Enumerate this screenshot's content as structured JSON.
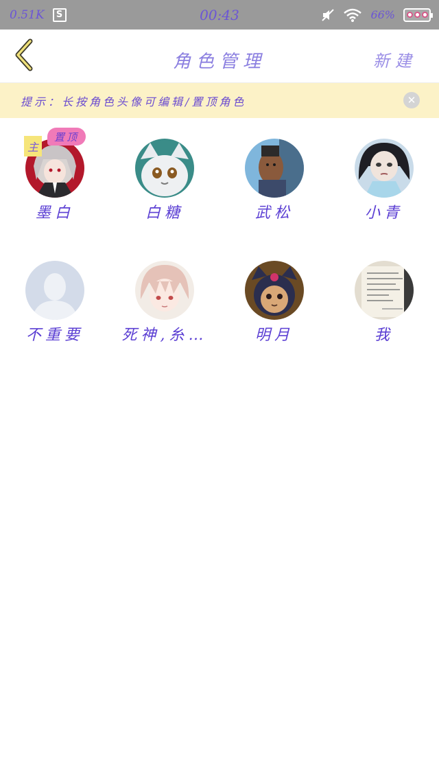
{
  "status_bar": {
    "speed": "0.51K",
    "time": "00:43",
    "battery_percent": "66%",
    "icons": [
      "s-app-icon",
      "mute-icon",
      "wifi-icon",
      "battery-icon"
    ]
  },
  "header": {
    "back_icon": "chevron-left-icon",
    "title": "角色管理",
    "new_label": "新建"
  },
  "hint": {
    "text": "提示：长按角色头像可编辑/置顶角色",
    "close_icon": "close-icon"
  },
  "characters": [
    {
      "name": "墨白",
      "badge_main": "主",
      "badge_pinned": "置顶"
    },
    {
      "name": "白糖"
    },
    {
      "name": "武松"
    },
    {
      "name": "小青"
    },
    {
      "name": "不重要"
    },
    {
      "name": "死神,糸…"
    },
    {
      "name": "明月"
    },
    {
      "name": "我"
    }
  ],
  "colors": {
    "status_bar_bg": "#9a9a9a",
    "hint_bg": "#fcf2c7",
    "name_text": "#5b3fd3",
    "pinned_badge": "#f07ab8",
    "main_badge": "#f6e57a"
  }
}
